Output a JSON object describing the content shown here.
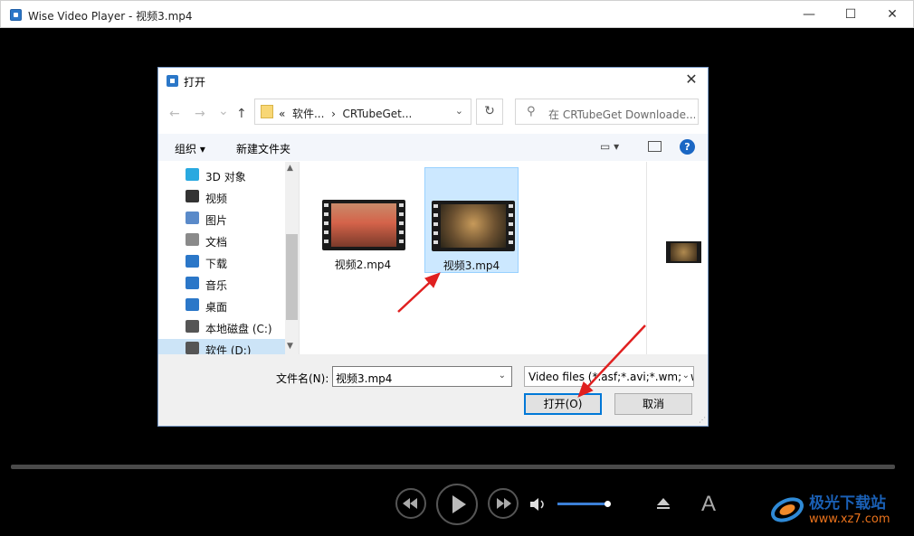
{
  "window": {
    "title": "Wise Video Player - 视频3.mp4",
    "minimize": "—",
    "maximize": "☐",
    "close": "✕"
  },
  "player": {
    "controls": [
      "rewind",
      "play",
      "forward",
      "volume",
      "eject",
      "subtitle"
    ],
    "subtitle_glyph": "A",
    "volume_level": 0.95
  },
  "dialog": {
    "title": "打开",
    "close": "✕",
    "nav": {
      "back": "←",
      "forward": "→",
      "recent": "⌄",
      "up": "↑"
    },
    "address": {
      "prefix": "«",
      "crumb1": "软件...",
      "sep": "›",
      "crumb2": "CRTubeGet...",
      "dropdown": "⌄"
    },
    "refresh": "↻",
    "search_placeholder": "在 CRTubeGet Downloade...",
    "toolbar": {
      "organize": "组织 ▾",
      "new_folder": "新建文件夹",
      "help": "?"
    },
    "nav_items": [
      {
        "label": "3D 对象",
        "icon": "cube-icon",
        "color": "#29a9e0"
      },
      {
        "label": "视频",
        "icon": "film-icon",
        "color": "#333"
      },
      {
        "label": "图片",
        "icon": "picture-icon",
        "color": "#5a8ac9"
      },
      {
        "label": "文档",
        "icon": "document-icon",
        "color": "#8a8a8a"
      },
      {
        "label": "下载",
        "icon": "download-icon",
        "color": "#2b77c8"
      },
      {
        "label": "音乐",
        "icon": "music-icon",
        "color": "#2b77c8"
      },
      {
        "label": "桌面",
        "icon": "desktop-icon",
        "color": "#2b77c8"
      },
      {
        "label": "本地磁盘 (C:)",
        "icon": "drive-c-icon",
        "color": "#555"
      },
      {
        "label": "软件 (D:)",
        "icon": "drive-d-icon",
        "color": "#555"
      }
    ],
    "files": [
      {
        "name": "视频2.mp4",
        "selected": false,
        "thumb_color": "#b74a34"
      },
      {
        "name": "视频3.mp4",
        "selected": true,
        "thumb_color": "#8a6a3a"
      }
    ],
    "filename_label": "文件名(N):",
    "filename_value": "视频3.mp4",
    "filetype_value": "Video files (*.asf;*.avi;*.wm;*.wmv",
    "open_button": "打开(O)",
    "cancel_button": "取消"
  },
  "watermark": {
    "top": "极光下载站",
    "bottom": "www.xz7.com"
  }
}
